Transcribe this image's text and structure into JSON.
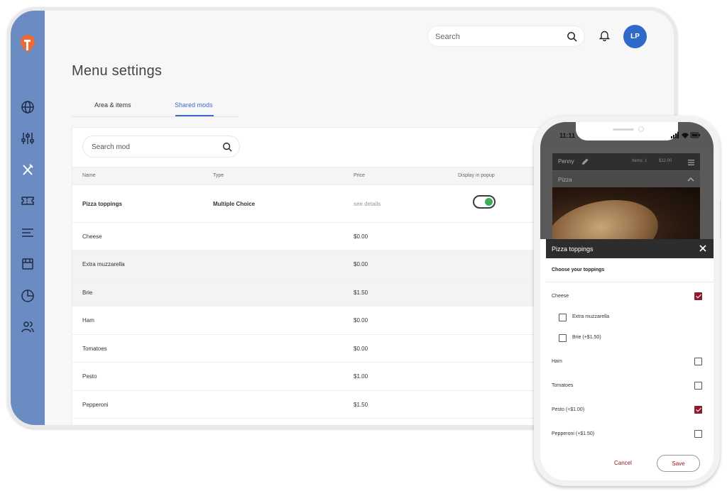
{
  "tablet": {
    "search_placeholder": "Search",
    "avatar_initials": "LP",
    "page_title": "Menu settings",
    "tabs": [
      {
        "label": "Area & items"
      },
      {
        "label": "Shared mods"
      }
    ],
    "mod_search_placeholder": "Search mod",
    "columns": [
      "Name",
      "Type",
      "Price",
      "Display in popup"
    ],
    "rows": [
      {
        "name": "Pizza toppings",
        "type": "Multiple Choice",
        "price": "see details"
      },
      {
        "name": "Cheese",
        "type": "",
        "price": "$0.00"
      },
      {
        "name": "Extra muzzarella",
        "type": "",
        "price": "$0.00"
      },
      {
        "name": "Brie",
        "type": "",
        "price": "$1.50"
      },
      {
        "name": "Ham",
        "type": "",
        "price": "$0.00"
      },
      {
        "name": "Tomatoes",
        "type": "",
        "price": "$0.00"
      },
      {
        "name": "Pesto",
        "type": "",
        "price": "$1.00"
      },
      {
        "name": "Pepperoni",
        "type": "",
        "price": "$1.50"
      }
    ],
    "display_in_popup": true,
    "colors": {
      "sidebar": "#6b8cc2",
      "accent": "#3d6bd1",
      "avatar": "#2f6ac9",
      "toggle_on": "#3fae58"
    }
  },
  "phone": {
    "time": "11:11",
    "order_name": "Penny",
    "items_count": "Items: 1",
    "order_total": "$12.00",
    "category": "Pizza",
    "modal_title": "Pizza toppings",
    "prompt": "Choose your toppings",
    "options": [
      {
        "label": "Cheese",
        "checked": true
      },
      {
        "label": "Extra muzzarella",
        "checked": false
      },
      {
        "label": "Brie (+$1.50)",
        "checked": false
      },
      {
        "label": "Ham",
        "checked": false
      },
      {
        "label": "Tomatoes",
        "checked": false
      },
      {
        "label": "Pesto (+$1.00)",
        "checked": true
      },
      {
        "label": "Pepperoni (+$1.50)",
        "checked": false
      }
    ],
    "cancel_label": "Cancel",
    "save_label": "Save",
    "colors": {
      "accent": "#8e1b2a"
    }
  }
}
